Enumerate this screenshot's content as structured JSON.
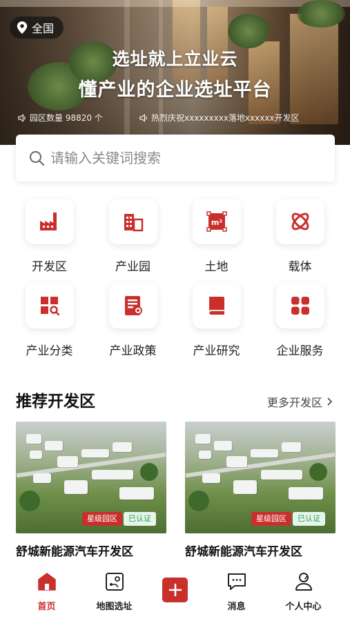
{
  "hero": {
    "location": "全国",
    "title_line1": "选址就上立业云",
    "title_line2": "懂产业的企业选址平台",
    "ticker_left": "园区数量 98820 个",
    "ticker_right": "热烈庆祝xxxxxxxxx落地xxxxxx开发区"
  },
  "search": {
    "placeholder": "请输入关键词搜索"
  },
  "categories": [
    {
      "label": "开发区",
      "icon": "factory-icon"
    },
    {
      "label": "产业园",
      "icon": "buildings-icon"
    },
    {
      "label": "土地",
      "icon": "land-area-icon"
    },
    {
      "label": "载体",
      "icon": "atom-icon"
    },
    {
      "label": "产业分类",
      "icon": "category-search-icon"
    },
    {
      "label": "产业政策",
      "icon": "policy-document-icon"
    },
    {
      "label": "产业研究",
      "icon": "book-icon"
    },
    {
      "label": "企业服务",
      "icon": "grid-service-icon"
    }
  ],
  "section": {
    "title": "推荐开发区",
    "more_label": "更多开发区"
  },
  "cards": [
    {
      "title": "舒城新能源汽车开发区",
      "badge_star": "星级园区",
      "badge_cert": "已认证"
    },
    {
      "title": "舒城新能源汽车开发区",
      "badge_star": "星级园区",
      "badge_cert": "已认证"
    }
  ],
  "nav": {
    "home": "首页",
    "map": "地图选址",
    "messages": "消息",
    "profile": "个人中心"
  },
  "colors": {
    "accent": "#c9302c",
    "cert_green": "#2f9c5a"
  }
}
